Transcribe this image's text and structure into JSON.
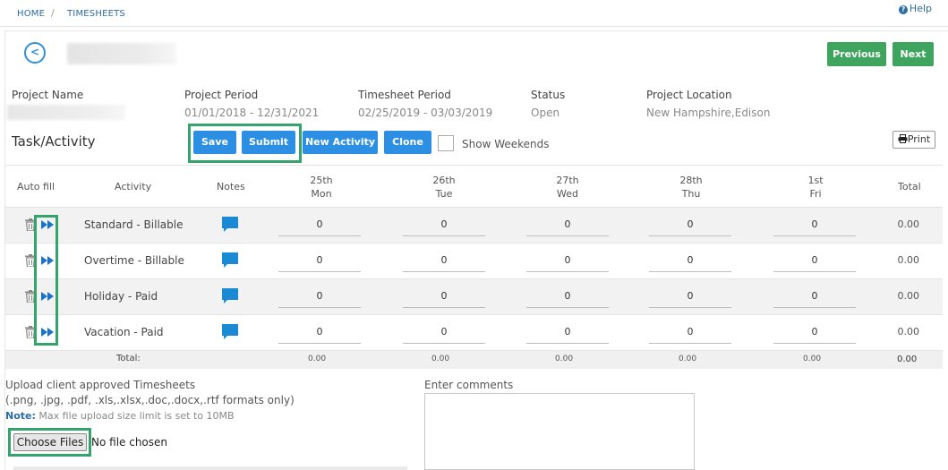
{
  "breadcrumb": {
    "home": "HOME",
    "separator": "/",
    "current": "TIMESHEETS"
  },
  "help_label": "Help",
  "nav": {
    "previous": "Previous",
    "next": "Next"
  },
  "project_info": [
    {
      "label": "Project Name",
      "value": ""
    },
    {
      "label": "Project Period",
      "value": "01/01/2018 - 12/31/2021"
    },
    {
      "label": "Timesheet Period",
      "value": "02/25/2019 - 03/03/2019"
    },
    {
      "label": "Status",
      "value": "Open"
    },
    {
      "label": "Project Location",
      "value": "New Hampshire,Edison"
    }
  ],
  "section_title": "Task/Activity",
  "toolbar": {
    "save": "Save",
    "submit": "Submit",
    "new_activity": "New Activity",
    "clone": "Clone",
    "show_weekends": "Show Weekends",
    "print": "Print"
  },
  "table": {
    "headers": {
      "auto_fill": "Auto fill",
      "activity": "Activity",
      "notes": "Notes",
      "total": "Total"
    },
    "days": [
      {
        "date": "25th",
        "day": "Mon"
      },
      {
        "date": "26th",
        "day": "Tue"
      },
      {
        "date": "27th",
        "day": "Wed"
      },
      {
        "date": "28th",
        "day": "Thu"
      },
      {
        "date": "1st",
        "day": "Fri"
      }
    ],
    "rows": [
      {
        "activity": "Standard - Billable",
        "hours": [
          "0",
          "0",
          "0",
          "0",
          "0"
        ],
        "total": "0.00"
      },
      {
        "activity": "Overtime - Billable",
        "hours": [
          "0",
          "0",
          "0",
          "0",
          "0"
        ],
        "total": "0.00"
      },
      {
        "activity": "Holiday - Paid",
        "hours": [
          "0",
          "0",
          "0",
          "0",
          "0"
        ],
        "total": "0.00"
      },
      {
        "activity": "Vacation - Paid",
        "hours": [
          "0",
          "0",
          "0",
          "0",
          "0"
        ],
        "total": "0.00"
      }
    ],
    "totals": {
      "label": "Total:",
      "values": [
        "0.00",
        "0.00",
        "0.00",
        "0.00",
        "0.00"
      ],
      "grand": "0.00"
    }
  },
  "upload": {
    "title": "Upload client approved Timesheets",
    "formats": "(.png, .jpg, .pdf, .xls,.xlsx,.doc,.docx,.rtf formats only)",
    "note_label": "Note:",
    "note_text": " Max file upload size limit is set to 10MB",
    "choose_button": "Choose Files",
    "no_file": "No file chosen"
  },
  "comments": {
    "label": "Enter comments",
    "value": ""
  },
  "colors": {
    "primary_blue": "#2d8fe3",
    "green": "#3fa55e",
    "highlight": "#35a36c",
    "note_icon": "#1a8ad4"
  }
}
